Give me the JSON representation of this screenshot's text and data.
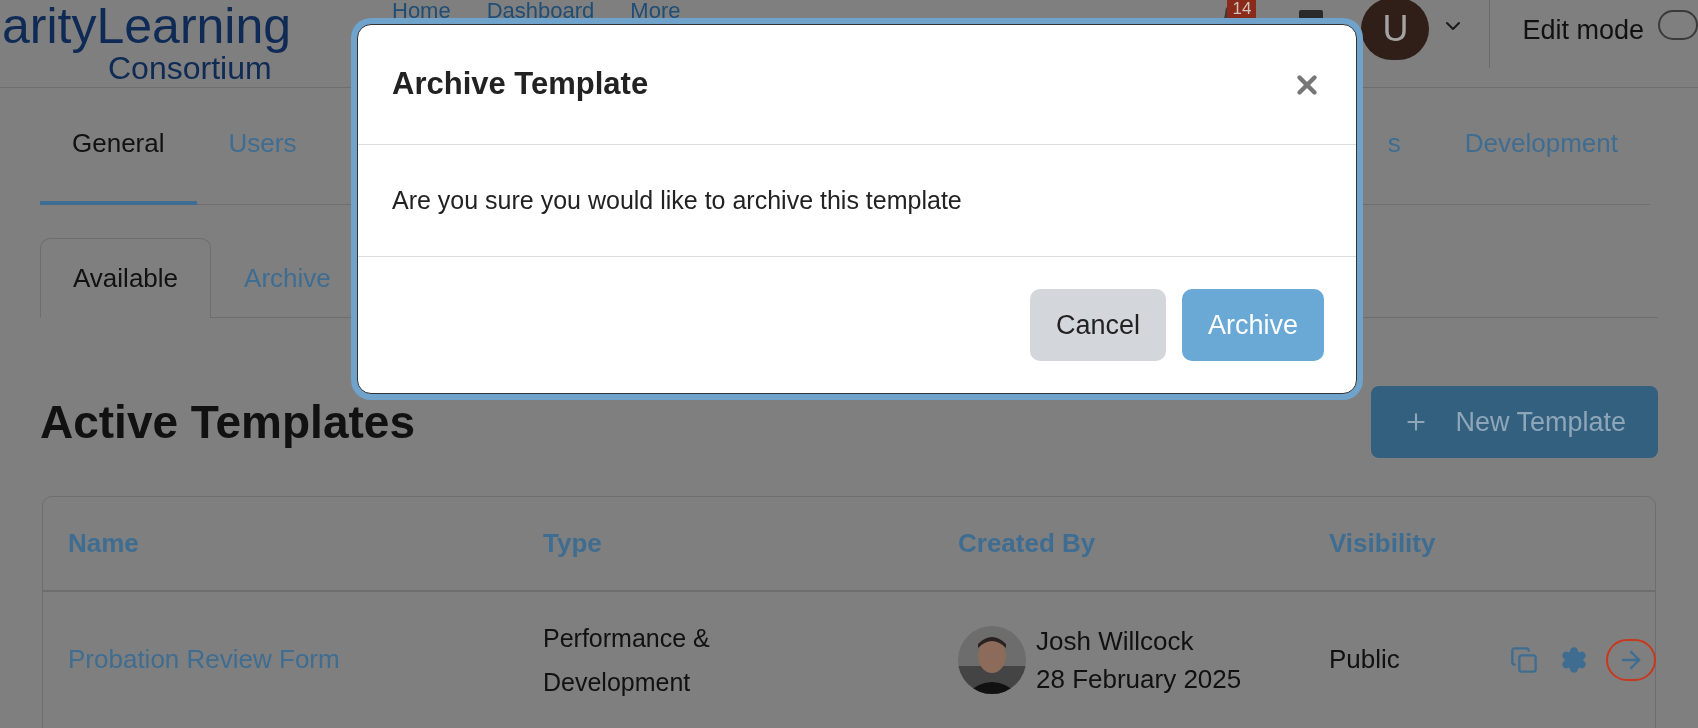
{
  "header": {
    "logo": {
      "line1": "arityLearning",
      "line2": "Consortium"
    },
    "nav": [
      "Home",
      "Dashboard",
      "More"
    ],
    "notification_count": "14",
    "avatar_letter": "U",
    "edit_mode_label": "Edit mode"
  },
  "tabs": [
    {
      "label": "General",
      "selected": true
    },
    {
      "label": "Users",
      "selected": false
    },
    {
      "label": "s",
      "selected": false
    },
    {
      "label": "Development",
      "selected": false
    }
  ],
  "subtabs": [
    {
      "label": "Available",
      "selected": true
    },
    {
      "label": "Archive",
      "selected": false
    }
  ],
  "heading": "Active Templates",
  "new_button": {
    "label": "New Template"
  },
  "table": {
    "columns": [
      "Name",
      "Type",
      "Created By",
      "Visibility"
    ],
    "rows": [
      {
        "name": "Probation Review Form",
        "type": "Performance & Development",
        "created_by": "Josh Willcock",
        "created_on": "28 February 2025",
        "visibility": "Public",
        "actions": [
          {
            "kind": "copy",
            "highlighted": false
          },
          {
            "kind": "settings",
            "highlighted": false
          },
          {
            "kind": "open",
            "highlighted": true
          }
        ]
      }
    ]
  },
  "modal": {
    "title": "Archive Template",
    "message": "Are you sure you would like to archive this template",
    "buttons": [
      {
        "label": "Cancel",
        "kind": "secondary"
      },
      {
        "label": "Archive",
        "kind": "primary"
      }
    ]
  }
}
